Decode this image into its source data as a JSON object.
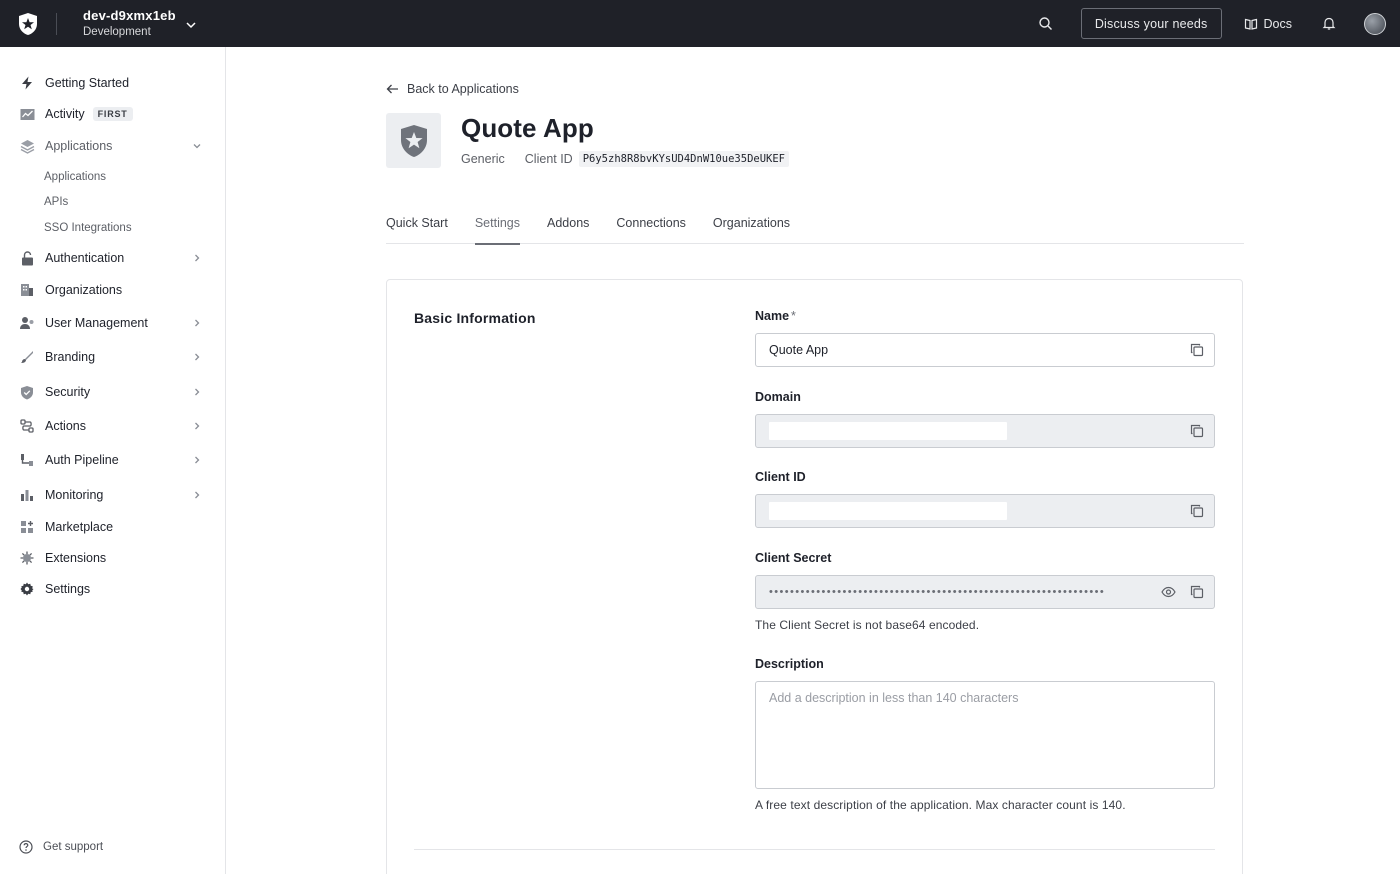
{
  "topbar": {
    "tenant_name": "dev-d9xmx1eb",
    "tenant_env": "Development",
    "discuss_label": "Discuss your needs",
    "docs_label": "Docs"
  },
  "sidebar": {
    "items": [
      {
        "label": "Getting Started",
        "icon": "bolt-icon"
      },
      {
        "label": "Activity",
        "icon": "activity-chart-icon",
        "badge": "FIRST"
      },
      {
        "label": "Applications",
        "icon": "layers-icon"
      },
      {
        "label": "Authentication",
        "icon": "lock-icon"
      },
      {
        "label": "Organizations",
        "icon": "building-icon"
      },
      {
        "label": "User Management",
        "icon": "users-icon"
      },
      {
        "label": "Branding",
        "icon": "brush-icon"
      },
      {
        "label": "Security",
        "icon": "shield-icon"
      },
      {
        "label": "Actions",
        "icon": "flow-icon"
      },
      {
        "label": "Auth Pipeline",
        "icon": "pipeline-icon"
      },
      {
        "label": "Monitoring",
        "icon": "bar-chart-icon"
      },
      {
        "label": "Marketplace",
        "icon": "grid-plus-icon"
      },
      {
        "label": "Extensions",
        "icon": "puzzle-gear-icon"
      },
      {
        "label": "Settings",
        "icon": "gear-icon"
      }
    ],
    "sub_items": [
      "Applications",
      "APIs",
      "SSO Integrations"
    ],
    "support_label": "Get support"
  },
  "header": {
    "back_label": "Back to Applications",
    "app_name": "Quote App",
    "app_type": "Generic",
    "client_id_label": "Client ID",
    "client_id_value": "P6y5zh8R8bvKYsUD4DnW10ue35DeUKEF"
  },
  "tabs": [
    {
      "label": "Quick Start",
      "active": false
    },
    {
      "label": "Settings",
      "active": true
    },
    {
      "label": "Addons",
      "active": false
    },
    {
      "label": "Connections",
      "active": false
    },
    {
      "label": "Organizations",
      "active": false
    }
  ],
  "basic_info": {
    "section_title": "Basic Information",
    "name_label": "Name",
    "name_required": "*",
    "name_value": "Quote App",
    "domain_label": "Domain",
    "client_id_label": "Client ID",
    "client_secret_label": "Client Secret",
    "client_secret_mask": "••••••••••••••••••••••••••••••••••••••••••••••••••••••••••••••••",
    "client_secret_help": "The Client Secret is not base64 encoded.",
    "description_label": "Description",
    "description_placeholder": "Add a description in less than 140 characters",
    "description_help": "A free text description of the application. Max character count is 140."
  },
  "colors": {
    "topbar_bg": "#1f2128",
    "text_primary": "#1e212a",
    "readonly_bg": "#eceef1",
    "border": "#c9ccd1"
  }
}
